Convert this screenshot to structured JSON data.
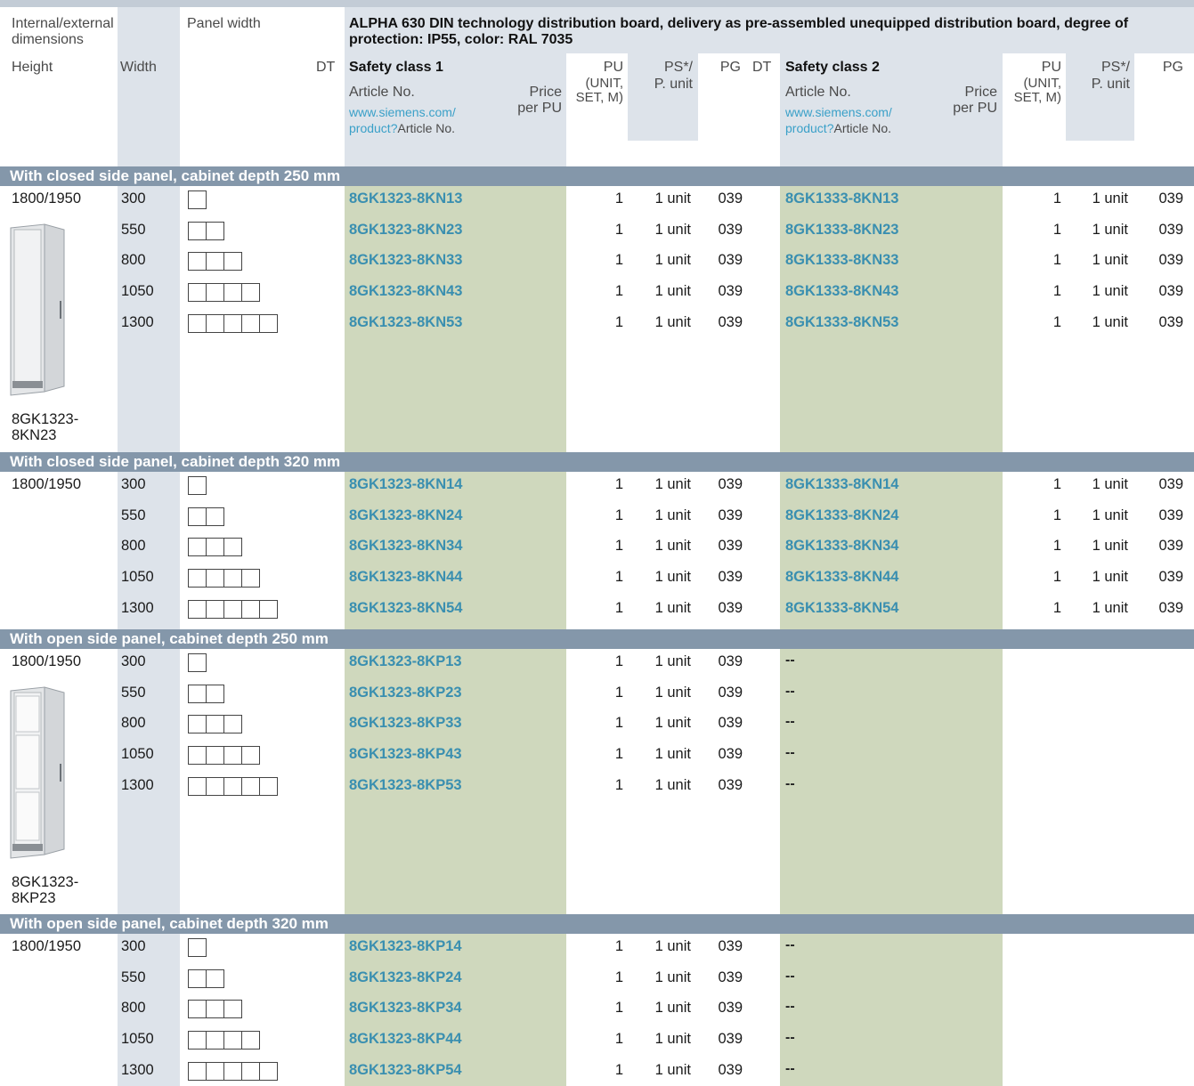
{
  "header": {
    "dims_label": "Internal/external dimensions",
    "panel_width_label": "Panel width",
    "title": "ALPHA 630 DIN technology distribution board, delivery as pre-assembled unequipped distribution board, degree of protection: IP55, color: RAL 7035",
    "height_label": "Height",
    "width_label": "Width",
    "dt_label": "DT",
    "safety_class_1": "Safety class 1",
    "safety_class_2": "Safety class 2",
    "article_no": "Article No.",
    "price_line1": "Price",
    "price_line2": "per PU",
    "url_line1": "www.siemens.com/",
    "url_line2": "product?",
    "url_suffix": "Article No.",
    "pu_line1": "PU",
    "pu_line2": "(UNIT,",
    "pu_line3": "SET, M)",
    "ps_line1": "PS*/",
    "ps_line2": "P. unit",
    "pg_label": "PG"
  },
  "sections": [
    {
      "title": "With closed side panel, cabinet depth 250 mm",
      "height": "1800/1950",
      "image_caption": [
        "8GK1323-",
        "8KN23"
      ],
      "rows": [
        {
          "width": "300",
          "boxes": 1,
          "sc1": "8GK1323-8KN13",
          "pu": "1",
          "ps": "1 unit",
          "pg": "039",
          "sc2": "8GK1333-8KN13",
          "pu2": "1",
          "ps2": "1 unit",
          "pg2": "039"
        },
        {
          "width": "550",
          "boxes": 2,
          "sc1": "8GK1323-8KN23",
          "pu": "1",
          "ps": "1 unit",
          "pg": "039",
          "sc2": "8GK1333-8KN23",
          "pu2": "1",
          "ps2": "1 unit",
          "pg2": "039"
        },
        {
          "width": "800",
          "boxes": 3,
          "sc1": "8GK1323-8KN33",
          "pu": "1",
          "ps": "1 unit",
          "pg": "039",
          "sc2": "8GK1333-8KN33",
          "pu2": "1",
          "ps2": "1 unit",
          "pg2": "039"
        },
        {
          "width": "1050",
          "boxes": 4,
          "sc1": "8GK1323-8KN43",
          "pu": "1",
          "ps": "1 unit",
          "pg": "039",
          "sc2": "8GK1333-8KN43",
          "pu2": "1",
          "ps2": "1 unit",
          "pg2": "039"
        },
        {
          "width": "1300",
          "boxes": 5,
          "sc1": "8GK1323-8KN53",
          "pu": "1",
          "ps": "1 unit",
          "pg": "039",
          "sc2": "8GK1333-8KN53",
          "pu2": "1",
          "ps2": "1 unit",
          "pg2": "039"
        }
      ]
    },
    {
      "title": "With closed side panel, cabinet depth 320 mm",
      "height": "1800/1950",
      "rows": [
        {
          "width": "300",
          "boxes": 1,
          "sc1": "8GK1323-8KN14",
          "pu": "1",
          "ps": "1 unit",
          "pg": "039",
          "sc2": "8GK1333-8KN14",
          "pu2": "1",
          "ps2": "1 unit",
          "pg2": "039"
        },
        {
          "width": "550",
          "boxes": 2,
          "sc1": "8GK1323-8KN24",
          "pu": "1",
          "ps": "1 unit",
          "pg": "039",
          "sc2": "8GK1333-8KN24",
          "pu2": "1",
          "ps2": "1 unit",
          "pg2": "039"
        },
        {
          "width": "800",
          "boxes": 3,
          "sc1": "8GK1323-8KN34",
          "pu": "1",
          "ps": "1 unit",
          "pg": "039",
          "sc2": "8GK1333-8KN34",
          "pu2": "1",
          "ps2": "1 unit",
          "pg2": "039"
        },
        {
          "width": "1050",
          "boxes": 4,
          "sc1": "8GK1323-8KN44",
          "pu": "1",
          "ps": "1 unit",
          "pg": "039",
          "sc2": "8GK1333-8KN44",
          "pu2": "1",
          "ps2": "1 unit",
          "pg2": "039"
        },
        {
          "width": "1300",
          "boxes": 5,
          "sc1": "8GK1323-8KN54",
          "pu": "1",
          "ps": "1 unit",
          "pg": "039",
          "sc2": "8GK1333-8KN54",
          "pu2": "1",
          "ps2": "1 unit",
          "pg2": "039"
        }
      ]
    },
    {
      "title": "With open side panel, cabinet depth 250 mm",
      "height": "1800/1950",
      "image_caption": [
        "8GK1323-",
        "8KP23"
      ],
      "rows": [
        {
          "width": "300",
          "boxes": 1,
          "sc1": "8GK1323-8KP13",
          "pu": "1",
          "ps": "1 unit",
          "pg": "039",
          "sc2": "--"
        },
        {
          "width": "550",
          "boxes": 2,
          "sc1": "8GK1323-8KP23",
          "pu": "1",
          "ps": "1 unit",
          "pg": "039",
          "sc2": "--"
        },
        {
          "width": "800",
          "boxes": 3,
          "sc1": "8GK1323-8KP33",
          "pu": "1",
          "ps": "1 unit",
          "pg": "039",
          "sc2": "--"
        },
        {
          "width": "1050",
          "boxes": 4,
          "sc1": "8GK1323-8KP43",
          "pu": "1",
          "ps": "1 unit",
          "pg": "039",
          "sc2": "--"
        },
        {
          "width": "1300",
          "boxes": 5,
          "sc1": "8GK1323-8KP53",
          "pu": "1",
          "ps": "1 unit",
          "pg": "039",
          "sc2": "--"
        }
      ]
    },
    {
      "title": "With open side panel, cabinet depth 320 mm",
      "height": "1800/1950",
      "rows": [
        {
          "width": "300",
          "boxes": 1,
          "sc1": "8GK1323-8KP14",
          "pu": "1",
          "ps": "1 unit",
          "pg": "039",
          "sc2": "--"
        },
        {
          "width": "550",
          "boxes": 2,
          "sc1": "8GK1323-8KP24",
          "pu": "1",
          "ps": "1 unit",
          "pg": "039",
          "sc2": "--"
        },
        {
          "width": "800",
          "boxes": 3,
          "sc1": "8GK1323-8KP34",
          "pu": "1",
          "ps": "1 unit",
          "pg": "039",
          "sc2": "--"
        },
        {
          "width": "1050",
          "boxes": 4,
          "sc1": "8GK1323-8KP44",
          "pu": "1",
          "ps": "1 unit",
          "pg": "039",
          "sc2": "--"
        },
        {
          "width": "1300",
          "boxes": 5,
          "sc1": "8GK1323-8KP54",
          "pu": "1",
          "ps": "1 unit",
          "pg": "039",
          "sc2": "--"
        }
      ]
    }
  ]
}
